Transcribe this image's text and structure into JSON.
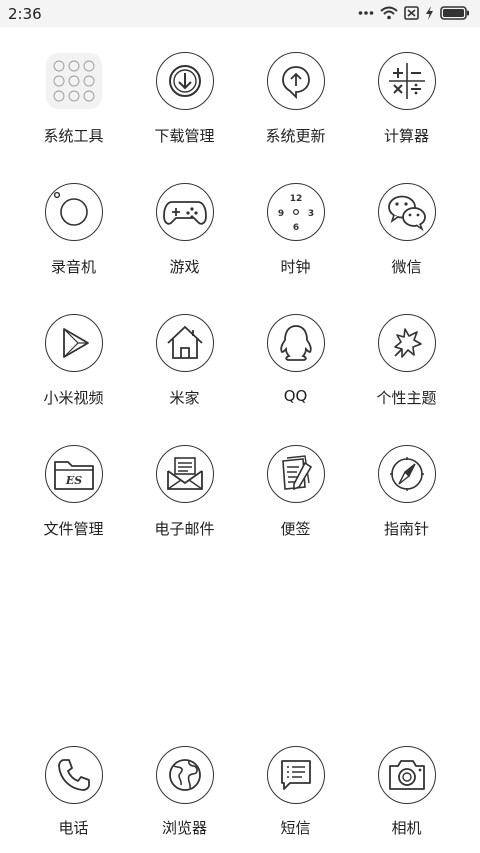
{
  "statusbar": {
    "time": "2:36",
    "icons": [
      "more-dots-icon",
      "wifi-icon",
      "no-sim-icon",
      "charging-bolt-icon",
      "battery-icon"
    ]
  },
  "apps": [
    {
      "label": "系统工具",
      "icon": "folder-grid-icon"
    },
    {
      "label": "下载管理",
      "icon": "download-icon"
    },
    {
      "label": "系统更新",
      "icon": "update-arrow-icon"
    },
    {
      "label": "计算器",
      "icon": "calculator-icon"
    },
    {
      "label": "录音机",
      "icon": "recorder-icon"
    },
    {
      "label": "游戏",
      "icon": "gamepad-icon"
    },
    {
      "label": "时钟",
      "icon": "clock-icon"
    },
    {
      "label": "微信",
      "icon": "wechat-icon"
    },
    {
      "label": "小米视频",
      "icon": "play-icon"
    },
    {
      "label": "米家",
      "icon": "home-icon"
    },
    {
      "label": "QQ",
      "icon": "penguin-icon"
    },
    {
      "label": "个性主题",
      "icon": "theme-icon"
    },
    {
      "label": "文件管理",
      "icon": "folder-icon"
    },
    {
      "label": "电子邮件",
      "icon": "mail-icon"
    },
    {
      "label": "便签",
      "icon": "notes-icon"
    },
    {
      "label": "指南针",
      "icon": "compass-icon"
    }
  ],
  "clock_numbers": [
    "12",
    "9",
    "3",
    "6"
  ],
  "file_icon_text": "ES",
  "dock": [
    {
      "label": "电话",
      "icon": "phone-icon"
    },
    {
      "label": "浏览器",
      "icon": "browser-globe-icon"
    },
    {
      "label": "短信",
      "icon": "message-icon"
    },
    {
      "label": "相机",
      "icon": "camera-icon"
    }
  ]
}
